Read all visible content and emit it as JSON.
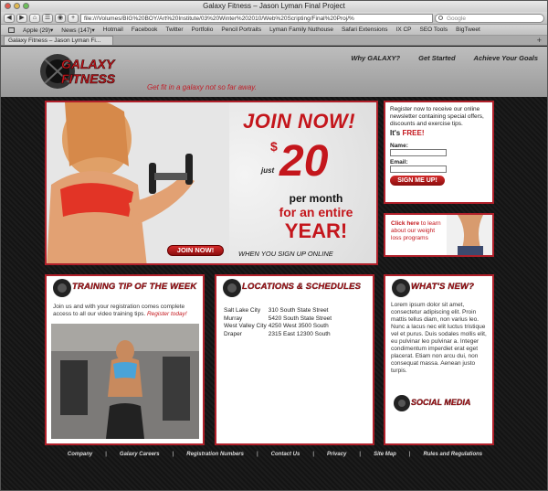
{
  "browser": {
    "window_title": "Galaxy Fitness – Jason Lyman Final Project",
    "url": "file:///Volumes/BIG%20BOY/Art%20Institute/03%20Winter%202010/Web%20Scripting/Final%20Proj/%",
    "search_placeholder": "Google",
    "toolbar": {
      "back": "◀",
      "forward": "▶",
      "home": "⌂",
      "reader": "☰",
      "history": "◉",
      "add": "+"
    },
    "bookmarks": [
      "Apple (29)▾",
      "News (147)▾",
      "Hotmail",
      "Facebook",
      "Twitter",
      "Portfolio",
      "Pencil Portraits",
      "Lyman Family Nuthouse",
      "Safari Extensions",
      "IX CP",
      "SEO Tools",
      "BigTweet"
    ],
    "tab_title": "Galaxy Fitness – Jason Lyman Fi...",
    "tab_add": "+"
  },
  "site": {
    "logo_line1": "GALAXY",
    "logo_line2": "FITNESS",
    "tagline": "Get fit in a galaxy not so far away.",
    "nav": [
      "Why GALAXY?",
      "Get Started",
      "Achieve Your Goals"
    ]
  },
  "hero": {
    "headline": "JOIN NOW!",
    "dollar": "$",
    "just": "just",
    "price": "20",
    "per_month": "per month",
    "entire": "for an entire",
    "year": "YEAR!",
    "when": "WHEN YOU SIGN UP ONLINE",
    "button": "JOIN NOW!"
  },
  "signup": {
    "intro": "Register now to receive our online newsletter containing special offers, discounts and exercise tips.",
    "free_prefix": "It's",
    "free_word": "FREE!",
    "name_label": "Name:",
    "email_label": "Email:",
    "button": "SIGN ME UP!"
  },
  "weight": {
    "link": "Click here",
    "text": "to learn about our weight loss programs"
  },
  "training": {
    "title": "TRAINING TIP OF THE WEEK",
    "body": "Join us and with your registration comes complete access to all our video training tips.",
    "register_link": "Register today!"
  },
  "locations": {
    "title": "LOCATIONS & SCHEDULES",
    "rows": [
      {
        "city": "Salt Lake City",
        "address": "310 South State Street"
      },
      {
        "city": "Murray",
        "address": "5420 South State Street"
      },
      {
        "city": "West Valley City",
        "address": "4250 West 3500 South"
      },
      {
        "city": "Draper",
        "address": "2315 East 12300 South"
      }
    ]
  },
  "news": {
    "title": "WHAT'S NEW?",
    "body": "Lorem ipsum dolor sit amet, consectetur adipiscing elit. Proin mattis tellus diam, non varius leo. Nunc a lacus nec elit luctus tristique vel et purus. Duis sodales mollis elit, eu pulvinar leo pulvinar a. Integer condimentum imperdiet erat eget placerat. Etiam non arcu dui, non consequat massa. Aenean justo turpis.",
    "social_title": "SOCIAL MEDIA"
  },
  "footer": {
    "links": [
      "Company",
      "Galaxy Careers",
      "Registration Numbers",
      "Contact Us",
      "Privacy",
      "Site Map",
      "Rules and Regulations"
    ],
    "separator": "|"
  },
  "colors": {
    "brand_red": "#c4161c",
    "panel_border": "#b0202a"
  }
}
